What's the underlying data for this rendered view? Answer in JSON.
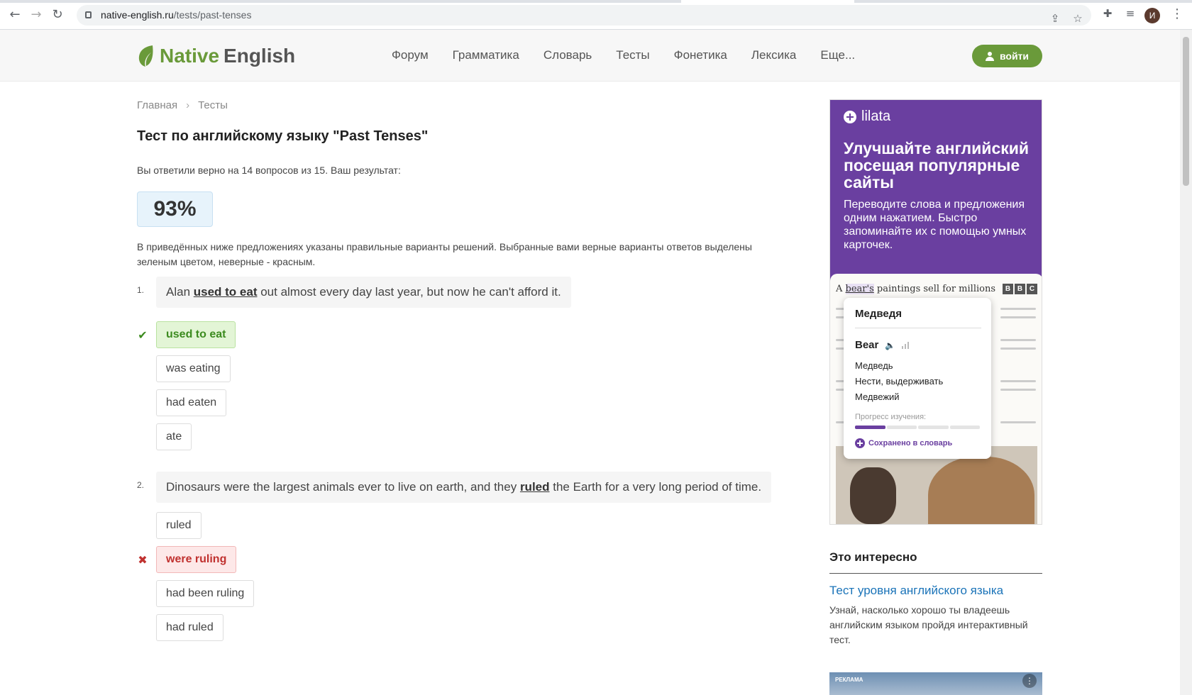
{
  "browser": {
    "url_domain": "native-english.ru",
    "url_path": "/tests/past-tenses",
    "profile_initial": "И"
  },
  "header": {
    "logo_native": "Native",
    "logo_english": "English",
    "nav": [
      "Форум",
      "Грамматика",
      "Словарь",
      "Тесты",
      "Фонетика",
      "Лексика",
      "Еще..."
    ],
    "login_label": "войти",
    "brand_color": "#6a9a3a"
  },
  "breadcrumb": {
    "home": "Главная",
    "current": "Тесты"
  },
  "page": {
    "title": "Тест по английскому языку \"Past Tenses\"",
    "result_text": "Вы ответили верно на 14 вопросов из 15. Ваш результат:",
    "score": "93%",
    "explanation": "В приведённых ниже предложениях указаны правильные варианты решений. Выбранные вами верные варианты ответов выделены зеленым цветом, неверные - красным."
  },
  "questions": [
    {
      "number": "1.",
      "before": "Alan ",
      "answer": "used to eat",
      "after": " out almost every day last year, but now he can't afford it.",
      "options": [
        {
          "label": "used to eat",
          "state": "correct"
        },
        {
          "label": "was eating",
          "state": "none"
        },
        {
          "label": "had eaten",
          "state": "none"
        },
        {
          "label": "ate",
          "state": "none"
        }
      ]
    },
    {
      "number": "2.",
      "before": "Dinosaurs were the largest animals ever to live on earth, and they ",
      "answer": "ruled",
      "after": " the Earth for a very long period of time.",
      "options": [
        {
          "label": "ruled",
          "state": "none"
        },
        {
          "label": "were ruling",
          "state": "wrong"
        },
        {
          "label": "had been ruling",
          "state": "none"
        },
        {
          "label": "had ruled",
          "state": "none"
        }
      ]
    }
  ],
  "ad": {
    "brand": "lilata",
    "headline": "Улучшайте английский посещая популярные сайты",
    "sub": "Переводите слова и предложения одним нажатием. Быстро запоминайте их с помощью умных карточек.",
    "paper_title_pre": "A ",
    "paper_title_hl": "bear's",
    "paper_title_post": " paintings sell for millions",
    "bbc": [
      "B",
      "B",
      "C"
    ],
    "popup": {
      "title": "Медведя",
      "word": "Bear",
      "translations": [
        "Медведь",
        "Нести, выдерживать",
        "Медвежий"
      ],
      "progress_label": "Прогресс изучения:",
      "progress_fraction": 0.25,
      "saved": "Сохранено в словарь"
    },
    "accent": "#6a3fa0"
  },
  "interesting": {
    "heading": "Это интересно",
    "link": "Тест уровня английского языка",
    "description": "Узнай, насколько хорошо ты владеешь английским языком пройдя интерактивный тест."
  },
  "ad2": {
    "label": "РЕКЛАМА"
  }
}
